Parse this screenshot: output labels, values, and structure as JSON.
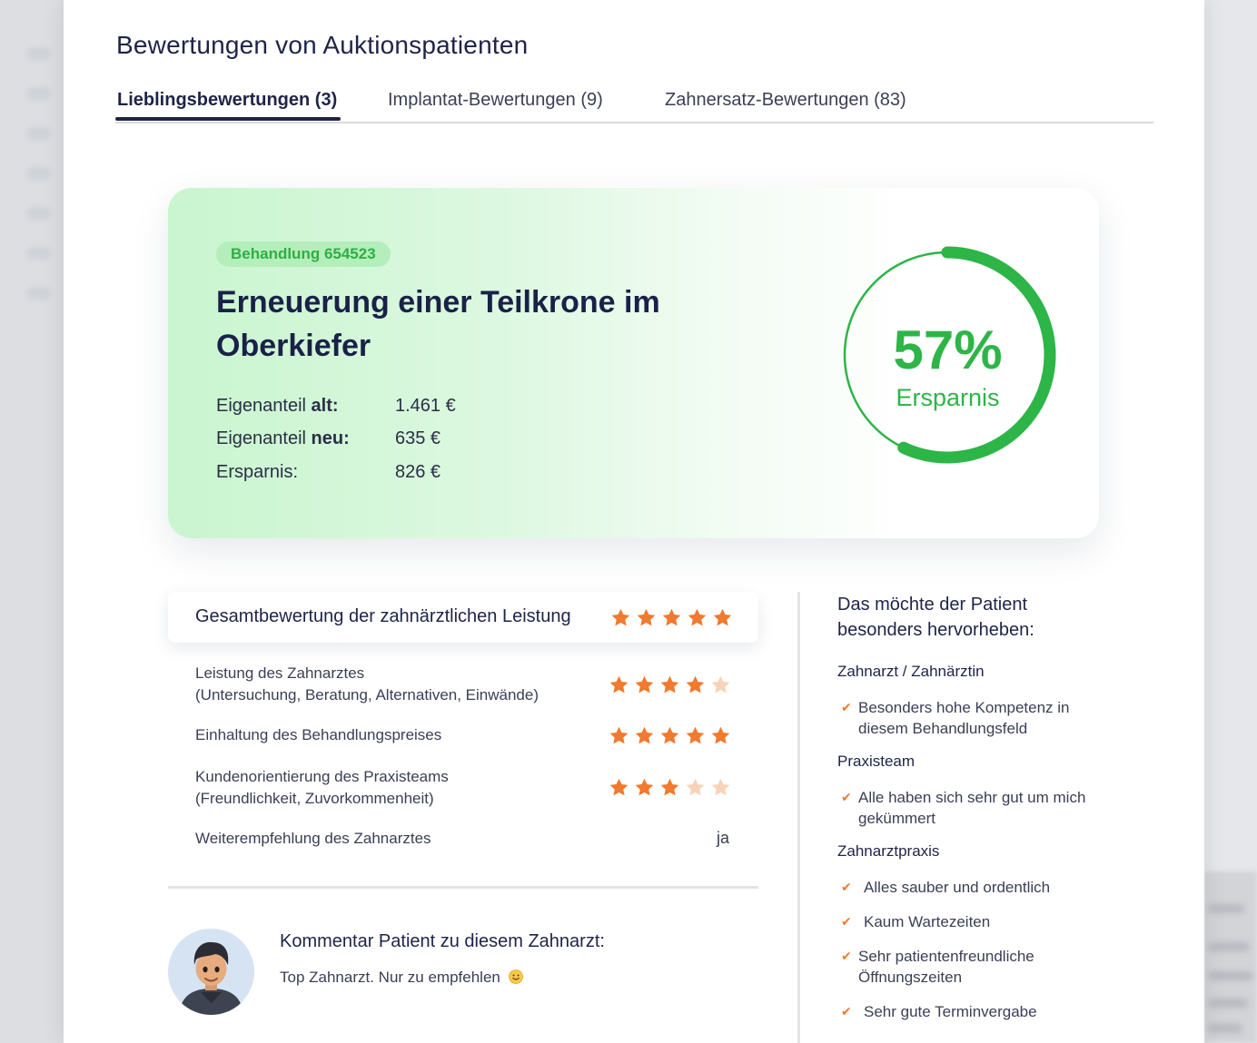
{
  "page": {
    "title": "Bewertungen von Auktionspatienten"
  },
  "tabs": [
    {
      "label": "Lieblingsbewertungen (3)",
      "active": true
    },
    {
      "label": "Implantat-Bewertungen (9)",
      "active": false
    },
    {
      "label": "Zahnersatz-Bewertungen (83)",
      "active": false
    }
  ],
  "hero": {
    "badge": "Behandlung 654523",
    "title": "Erneuerung einer Teilkrone im Oberkiefer",
    "costs": [
      {
        "label_prefix": "Eigenanteil ",
        "label_bold": "alt:",
        "value": "1.461 €"
      },
      {
        "label_prefix": "Eigenanteil ",
        "label_bold": "neu:",
        "value": "635 €"
      },
      {
        "label_prefix": "Ersparnis:",
        "label_bold": "",
        "value": "826 €"
      }
    ],
    "savings": {
      "percent_text": "57%",
      "fraction": 0.57,
      "label": "Ersparnis"
    }
  },
  "overall": {
    "label": "Gesamtbewertung der zahnärztlichen Leistung",
    "stars": 5
  },
  "ratings": [
    {
      "line1": "Leistung des Zahnarztes",
      "line2": "(Untersuchung, Beratung, Alternativen, Einwände)",
      "stars": 4
    },
    {
      "line1": "Einhaltung des Behandlungspreises",
      "line2": "",
      "stars": 5
    },
    {
      "line1": "Kundenorientierung des Praxisteams",
      "line2": "(Freundlichkeit, Zuvorkommenheit)",
      "stars": 3
    },
    {
      "line1": "Weiterempfehlung des Zahnarztes",
      "line2": "",
      "text": "ja"
    }
  ],
  "comment": {
    "title": "Kommentar Patient zu diesem Zahnarzt:",
    "text": "Top Zahnarzt. Nur zu empfehlen",
    "emoji_icon": "smiley-icon"
  },
  "highlights": {
    "title": "Das möchte der Patient besonders hervorheben:",
    "sections": [
      {
        "category": "Zahnarzt / Zahnärztin",
        "items": [
          "Besonders hohe Kompetenz in diesem Behandlungsfeld"
        ]
      },
      {
        "category": "Praxisteam",
        "items": [
          "Alle haben sich sehr gut um mich gekümmert"
        ]
      },
      {
        "category": "Zahnarztpraxis",
        "items": [
          "Alles sauber und ordentlich",
          "Kaum Wartezeiten",
          "Sehr patientenfreundliche Öffnungszeiten",
          "Sehr gute Terminvergabe"
        ]
      }
    ]
  },
  "colors": {
    "accent_green": "#2db547",
    "star_orange": "#f07a2e",
    "star_empty": "#f8d3b8",
    "navy": "#1e2447"
  }
}
